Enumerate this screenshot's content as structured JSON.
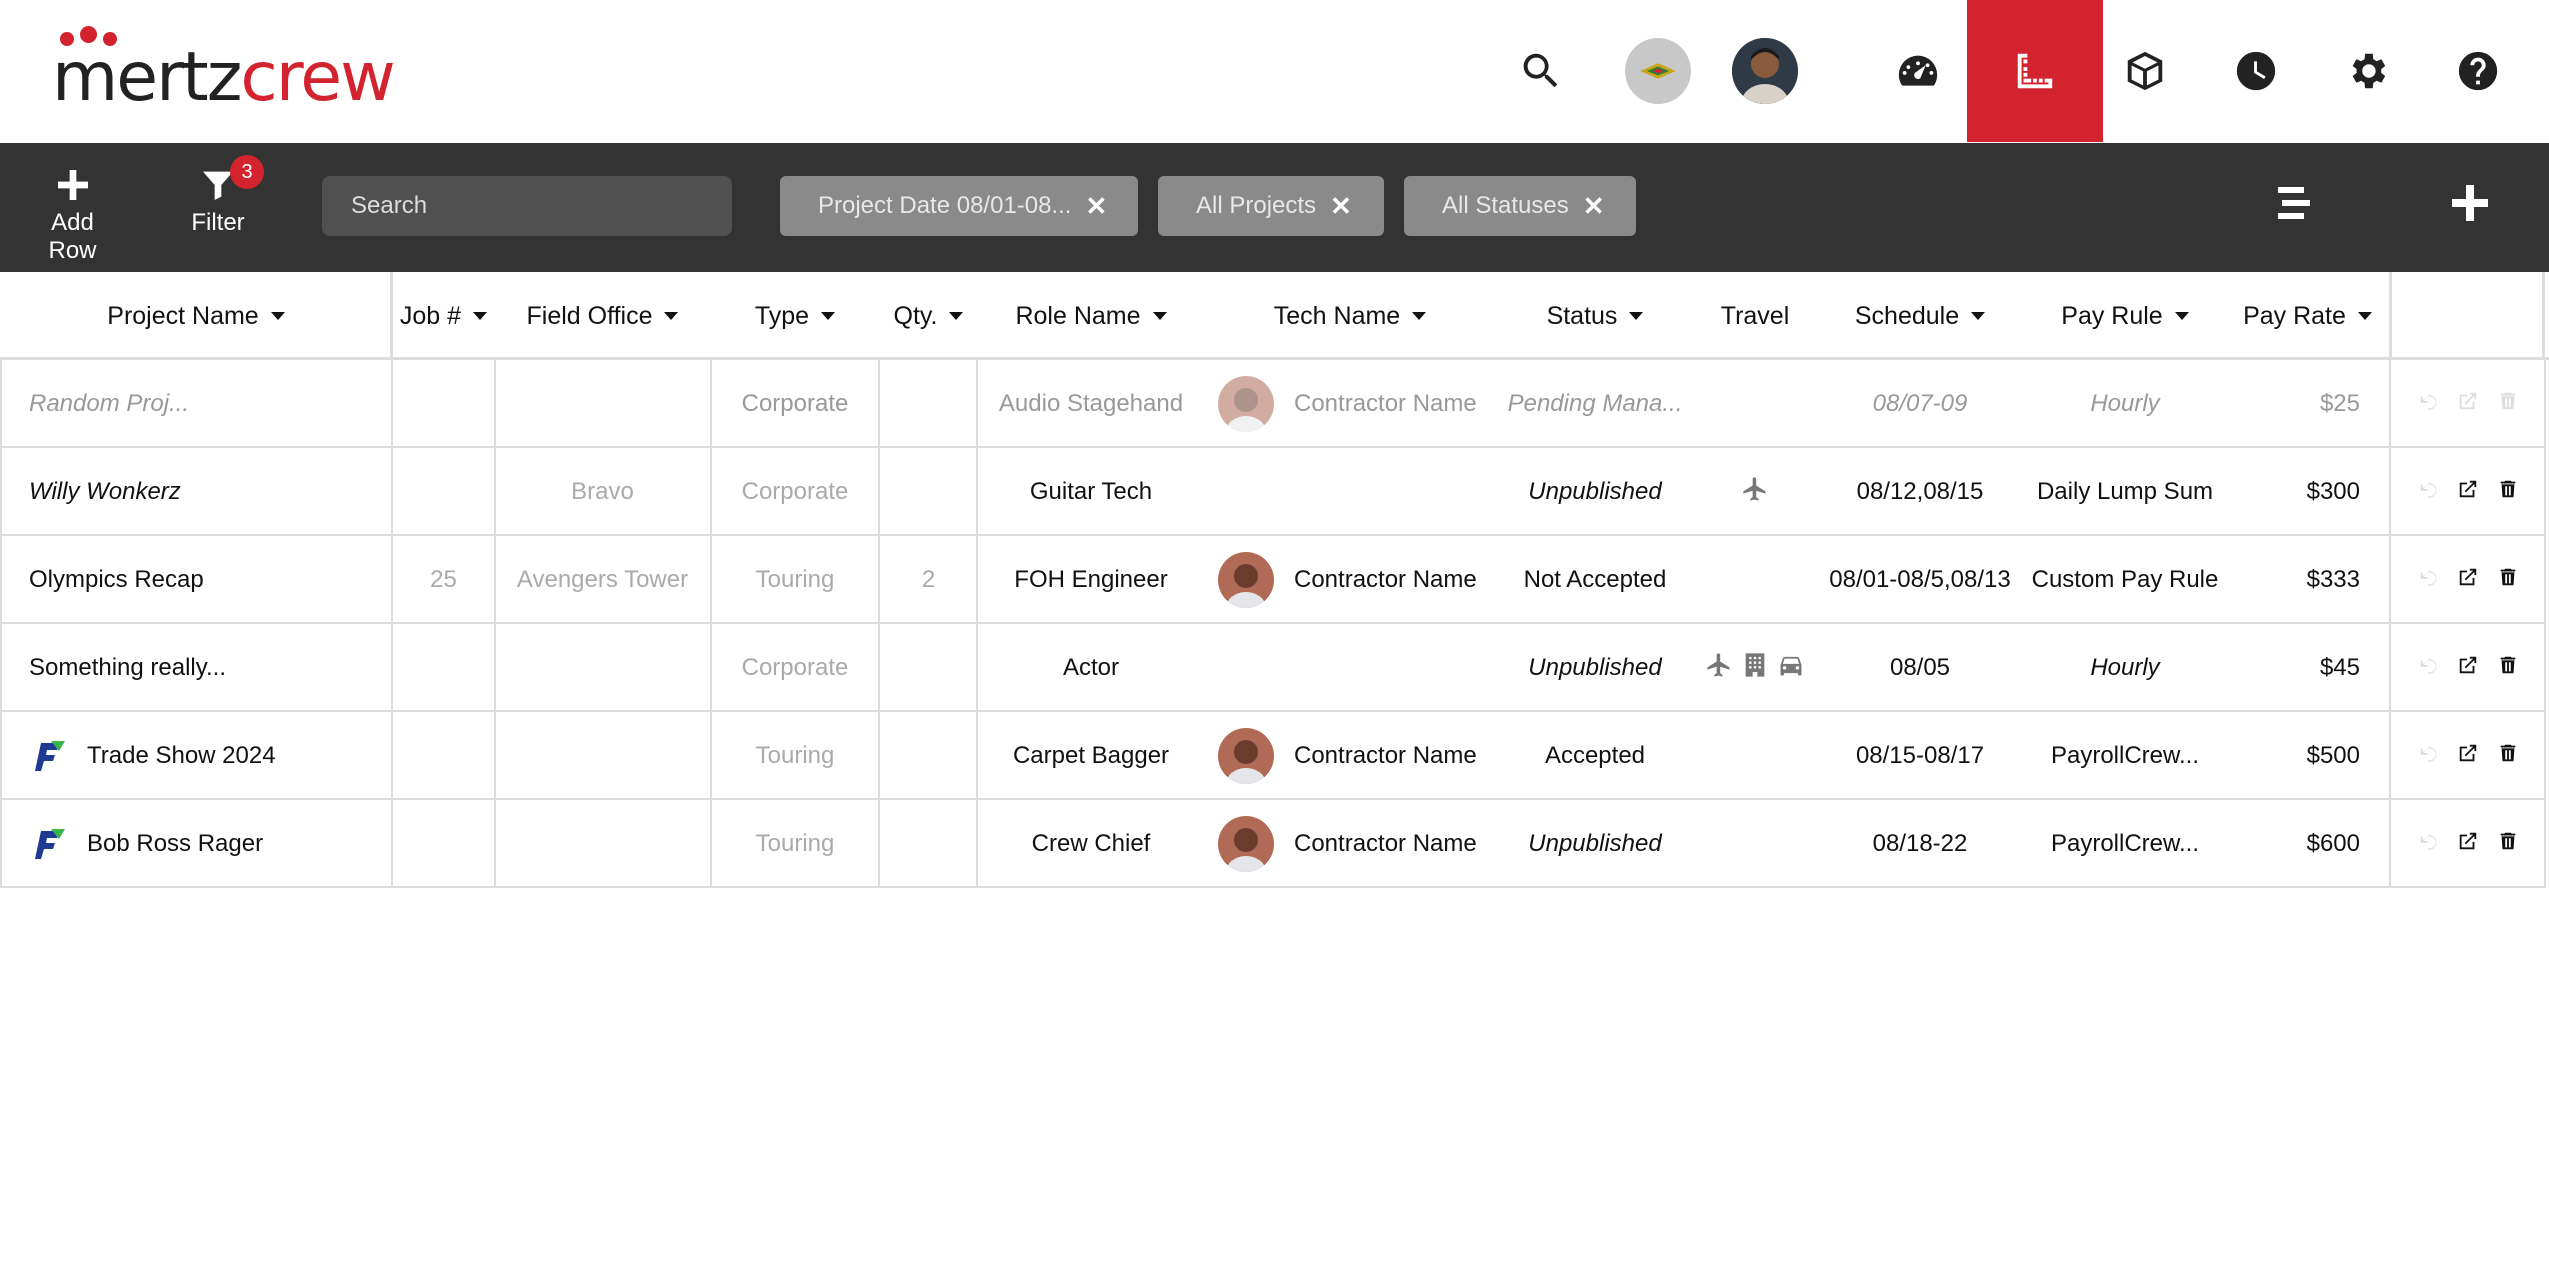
{
  "brand": {
    "part1": "mertz",
    "part2": "crew",
    "accent": "#d3232f"
  },
  "header": {
    "icons": [
      "search-icon",
      "org-avatar",
      "user-avatar",
      "dashboard-icon",
      "ruler-icon",
      "box-icon",
      "clock-icon",
      "gear-icon",
      "help-icon"
    ],
    "active_icon": "ruler-icon"
  },
  "toolbar": {
    "add_row_label": "Add Row",
    "filter_label": "Filter",
    "filter_count": "3",
    "search_placeholder": "Search",
    "chips": [
      {
        "label": "Project Date 08/01-08..."
      },
      {
        "label": "All Projects"
      },
      {
        "label": "All Statuses"
      }
    ]
  },
  "table": {
    "columns": {
      "project_name": "Project Name",
      "job": "Job #",
      "field_office": "Field Office",
      "type": "Type",
      "qty": "Qty.",
      "role_name": "Role Name",
      "tech_name": "Tech Name",
      "status": "Status",
      "travel": "Travel",
      "schedule": "Schedule",
      "pay_rule": "Pay Rule",
      "pay_rate": "Pay Rate"
    },
    "rows": [
      {
        "project": "Random Proj...",
        "job": "",
        "office": "",
        "type": "Corporate",
        "qty": "",
        "role": "Audio  Stagehand",
        "tech": "Contractor Name",
        "status": "Pending Mana...",
        "schedule": "08/07-09",
        "pay_rule": "Hourly",
        "pay_rate": "$25"
      },
      {
        "project": "Willy Wonkerz",
        "job": "",
        "office": "Bravo",
        "type": "Corporate",
        "qty": "",
        "role": "Guitar Tech",
        "tech": "",
        "status": "Unpublished",
        "schedule": "08/12,08/15",
        "pay_rule": "Daily Lump Sum",
        "pay_rate": "$300"
      },
      {
        "project": "Olympics Recap",
        "job": "25",
        "office": "Avengers Tower",
        "type": "Touring",
        "qty": "2",
        "role": "FOH Engineer",
        "tech": "Contractor Name",
        "status": "Not Accepted",
        "schedule": "08/01-08/5,08/13",
        "pay_rule": "Custom Pay Rule",
        "pay_rate": "$333"
      },
      {
        "project": "Something really...",
        "job": "",
        "office": "",
        "type": "Corporate",
        "qty": "",
        "role": "Actor",
        "tech": "",
        "status": "Unpublished",
        "schedule": "08/05",
        "pay_rule": "Hourly",
        "pay_rate": "$45"
      },
      {
        "project": "Trade Show 2024",
        "job": "",
        "office": "",
        "type": "Touring",
        "qty": "",
        "role": "Carpet Bagger",
        "tech": "Contractor Name",
        "status": "Accepted",
        "schedule": "08/15-08/17",
        "pay_rule": "PayrollCrew...",
        "pay_rate": "$500"
      },
      {
        "project": "Bob Ross Rager",
        "job": "",
        "office": "",
        "type": "Touring",
        "qty": "",
        "role": "Crew Chief",
        "tech": "Contractor Name",
        "status": "Unpublished",
        "schedule": "08/18-22",
        "pay_rule": "PayrollCrew...",
        "pay_rate": "$600"
      }
    ]
  }
}
